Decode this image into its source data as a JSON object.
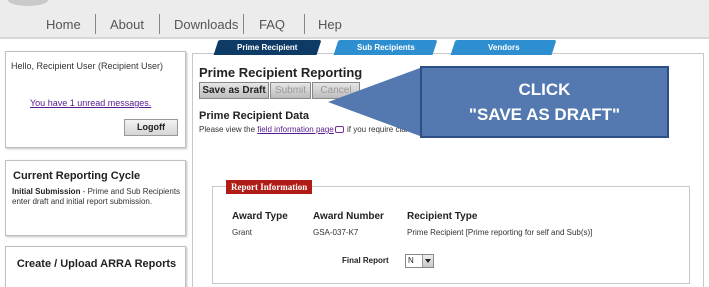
{
  "nav": {
    "items": [
      "Home",
      "About",
      "Downloads",
      "FAQ",
      "Hep"
    ]
  },
  "sidebar": {
    "greeting": "Hello, Recipient User (Recipient User)",
    "unread_link": "You have 1 unread messages.",
    "logoff_label": "Logoff",
    "cycle_title": "Current Reporting Cycle",
    "cycle_bold": "Initial Submission",
    "cycle_text": " - Prime and Sub Recipients enter draft and initial report submission.",
    "create_title": "Create / Upload ARRA Reports"
  },
  "tabs": [
    "Prime Recipient",
    "Sub Recipients",
    "Vendors"
  ],
  "main": {
    "title": "Prime Recipient Reporting",
    "save_draft_label": "Save as Draft",
    "submit_label": "Submit",
    "cancel_label": "Cancel",
    "section_title": "Prime Recipient Data",
    "info_prefix": "Please view the ",
    "info_link": "field information page",
    "info_suffix": " if you require clarification about the fields that appear on this form."
  },
  "report": {
    "tag": "Report Information",
    "columns": [
      "Award Type",
      "Award Number",
      "Recipient Type"
    ],
    "values": [
      "Grant",
      "GSA-037-K7",
      "Prime Recipient [Prime reporting for self and Sub(s)]"
    ],
    "final_label": "Final Report",
    "final_value": "N"
  },
  "callout": {
    "line1": "CLICK",
    "line2": "\"SAVE AS DRAFT\""
  },
  "colors": {
    "tab_active": "#0e3a66",
    "tab_inactive": "#2e8fd0",
    "report_tag": "#b01d16",
    "callout": "#5478b0",
    "link": "#551a8b"
  }
}
